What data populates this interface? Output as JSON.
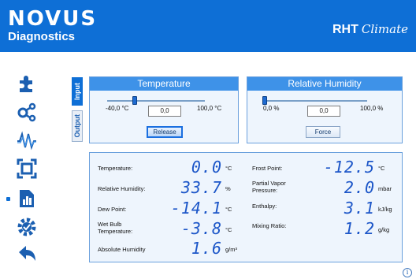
{
  "header": {
    "logo": "NOVUS",
    "subtitle": "Diagnostics",
    "product": "RHT",
    "product_script": "Climate"
  },
  "nav": {
    "items": [
      "puzzle-icon",
      "connections-icon",
      "signal-icon",
      "frame-icon",
      "diagnostics-icon",
      "settings-icon",
      "back-icon"
    ],
    "active_index": 4
  },
  "tabs": {
    "input": "Input",
    "output": "Output",
    "active": "Input"
  },
  "temperature": {
    "title": "Temperature",
    "min_label": "-40,0 °C",
    "max_label": "100,0 °C",
    "value": "0,0",
    "slider_fraction": 0.286,
    "button_label": "Release"
  },
  "humidity": {
    "title": "Relative Humidity",
    "min_label": "0,0 %",
    "max_label": "100,0 %",
    "value": "0,0",
    "slider_fraction": 0.0,
    "button_label": "Force"
  },
  "readings": {
    "temperature": {
      "label": "Temperature:",
      "value": "0.0",
      "unit": "°C"
    },
    "relative_humidity": {
      "label": "Relative Humidity:",
      "value": "33.7",
      "unit": "%"
    },
    "dew_point": {
      "label": "Dew Point:",
      "value": "-14.1",
      "unit": "°C"
    },
    "wet_bulb": {
      "label": "Wet Bulb Temperature:",
      "value": "-3.8",
      "unit": "°C"
    },
    "absolute_humidity": {
      "label": "Absolute Humidity",
      "value": "1.6",
      "unit": "g/m³"
    },
    "frost_point": {
      "label": "Frost Point:",
      "value": "-12.5",
      "unit": "°C"
    },
    "partial_vapor": {
      "label": "Partial Vapor Pressure:",
      "value": "2.0",
      "unit": "mbar"
    },
    "enthalpy": {
      "label": "Enthalpy:",
      "value": "3.1",
      "unit": "kJ/kg"
    },
    "mixing_ratio": {
      "label": "Mixing Ratio:",
      "value": "1.2",
      "unit": "g/kg"
    }
  },
  "info_icon": "i",
  "colors": {
    "brand": "#0e6fd6",
    "digits": "#1c56c8",
    "panel": "#eef5fd"
  }
}
